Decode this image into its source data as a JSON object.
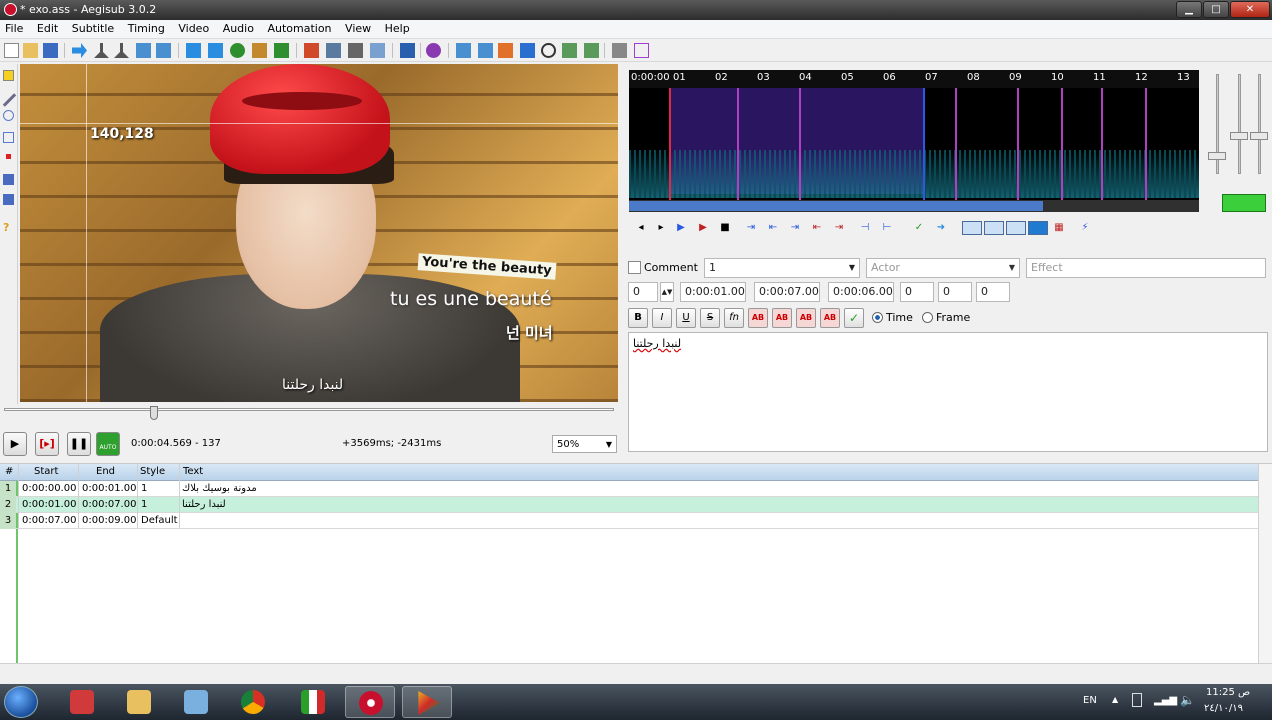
{
  "window": {
    "title": "* exo.ass - Aegisub 3.0.2",
    "minimize": "▁",
    "maximize": "□",
    "close": "✕"
  },
  "menu": [
    "File",
    "Edit",
    "Subtitle",
    "Timing",
    "Video",
    "Audio",
    "Automation",
    "View",
    "Help"
  ],
  "video": {
    "coord_readout": "140,128",
    "burned_text_en": "You're the beauty",
    "burned_text_fr": "tu es une beauté",
    "burned_text_ko": "넌 미녀",
    "subtitle_overlay": "لنبدا رحلتنا",
    "current_time": "0:00:04.569 - 137",
    "offset": "+3569ms; -2431ms",
    "zoom": "50%",
    "auto_label": "AUTO"
  },
  "audio": {
    "ticks": [
      "0:00:00",
      "01",
      "02",
      "03",
      "04",
      "05",
      "06",
      "07",
      "08",
      "09",
      "10",
      "11",
      "12",
      "13"
    ]
  },
  "editor": {
    "comment_label": "Comment",
    "style_value": "1",
    "actor_placeholder": "Actor",
    "effect_placeholder": "Effect",
    "layer": "0",
    "start_time": "0:00:01.00",
    "end_time": "0:00:07.00",
    "duration": "0:00:06.00",
    "margin_l": "0",
    "margin_r": "0",
    "margin_v": "0",
    "format_buttons": [
      "B",
      "I",
      "U",
      "S",
      "fn"
    ],
    "color_buttons": [
      "AB",
      "AB",
      "AB",
      "AB"
    ],
    "time_label": "Time",
    "frame_label": "Frame",
    "mode": "Time",
    "text": "لنبدا رحلتنا"
  },
  "grid": {
    "columns": [
      "#",
      "Start",
      "End",
      "Style",
      "Text"
    ],
    "rows": [
      {
        "num": "1",
        "start": "0:00:00.00",
        "end": "0:00:01.00",
        "style": "1",
        "text": "مدونة بوسيك بلاك"
      },
      {
        "num": "2",
        "start": "0:00:01.00",
        "end": "0:00:07.00",
        "style": "1",
        "text": "لنبدا رحلتنا"
      },
      {
        "num": "3",
        "start": "0:00:07.00",
        "end": "0:00:09.00",
        "style": "Default",
        "text": ""
      }
    ],
    "selected_row": "2"
  },
  "taskbar": {
    "lang": "EN",
    "time": "11:25 ص",
    "date": "٢٤/١٠/١٩"
  },
  "colors": {
    "accent": "#c7f0dc",
    "waveform_bg": "#000000",
    "purple_selection": "#2a1660",
    "marker_red": "#e0284a",
    "marker_purple": "#b040c0"
  }
}
